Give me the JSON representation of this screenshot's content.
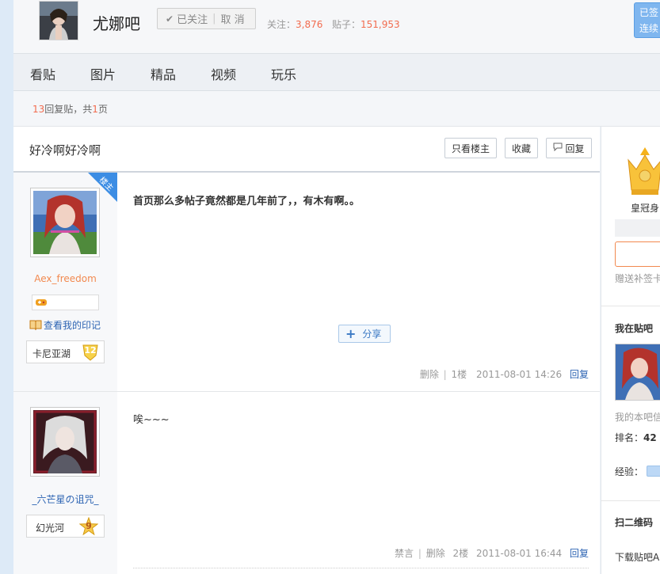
{
  "header": {
    "bar_name": "尤娜吧",
    "follow": {
      "followed_label": "已关注",
      "cancel_label": "取 消"
    },
    "stats": {
      "follow_label": "关注：",
      "follow_count": "3,876",
      "posts_label": "贴子：",
      "posts_count": "151,953"
    },
    "sign": {
      "line1": "已签",
      "line2": "连续"
    }
  },
  "nav": {
    "items": [
      "看贴",
      "图片",
      "精品",
      "视频",
      "玩乐"
    ]
  },
  "pager": {
    "reply_count": "13",
    "reply_suffix": "回复贴，共",
    "pages": "1",
    "pages_suffix": "页"
  },
  "thread": {
    "title": "好冷啊好冷啊",
    "buttons": {
      "only_op": "只看楼主",
      "favorite": "收藏",
      "reply": "回复"
    }
  },
  "posts": [
    {
      "username": "Aex_freedom",
      "op_badge": "楼主",
      "yinji": "查看我的印记",
      "badge_name": "卡尼亚湖",
      "badge_level": "12",
      "content": "首页那么多帖子竟然都是几年前了，，有木有啊。。",
      "share": "分享",
      "tail": {
        "delete": "删除",
        "sep": "|",
        "floor": "1楼",
        "time": "2011-08-01 14:26",
        "reply": "回复"
      }
    },
    {
      "username": "_六芒星の诅咒_",
      "badge_name": "幻光河",
      "badge_level": "9",
      "content": "唉~~~",
      "tail": {
        "ban": "禁言",
        "sep": "|",
        "delete": "删除",
        "floor": "2楼",
        "time": "2011-08-01 16:44",
        "reply": "回复"
      }
    }
  ],
  "right": {
    "crown_label": "皇冠身",
    "buqian": "赠送补签卡",
    "my_in_bar": "我在贴吧",
    "my_info": "我的本吧信",
    "rank_label": "排名：",
    "rank_value": "42",
    "exp_label": "经验：",
    "qr_title": "扫二维码",
    "download": "下载贴吧A"
  },
  "colors": {
    "accent_orange": "#f26c4f",
    "link_blue": "#2d64b3",
    "sign_blue": "#7fb6ef"
  }
}
